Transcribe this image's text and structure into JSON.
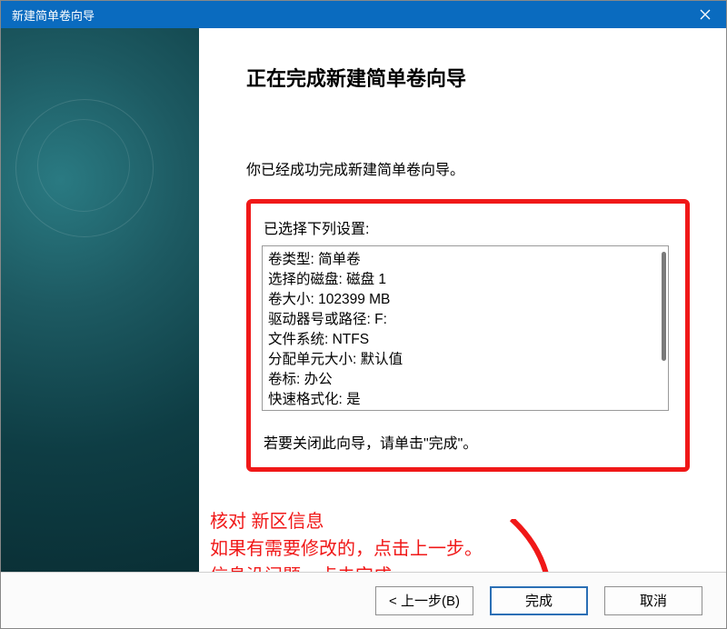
{
  "window": {
    "title": "新建简单卷向导"
  },
  "main": {
    "heading": "正在完成新建简单卷向导",
    "intro": "你已经成功完成新建简单卷向导。",
    "settingsLabel": "已选择下列设置:",
    "settings": {
      "volumeType": "卷类型: 简单卷",
      "disk": "选择的磁盘: 磁盘 1",
      "size": "卷大小: 102399 MB",
      "drive": "驱动器号或路径: F:",
      "fs": "文件系统: NTFS",
      "alloc": "分配单元大小: 默认值",
      "label": "卷标: 办公",
      "quickFormat": "快速格式化: 是"
    },
    "closeHint": "若要关闭此向导，请单击\"完成\"。"
  },
  "annotation": {
    "line1": "核对 新区信息",
    "line2": "如果有需要修改的，点击上一步。",
    "line3": "信息没问题，点击完成。"
  },
  "footer": {
    "back": "< 上一步(B)",
    "finish": "完成",
    "cancel": "取消"
  }
}
